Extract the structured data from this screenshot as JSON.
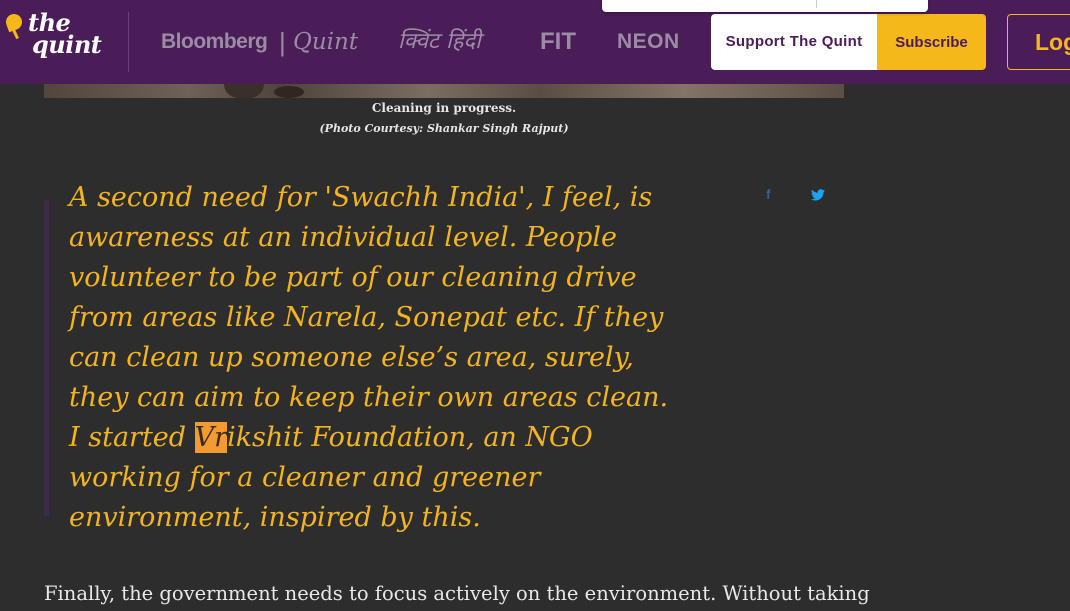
{
  "header": {
    "logo_top": "the",
    "logo_bottom": "quint",
    "brands": {
      "bloomberg": "Bloomberg",
      "separator": "|",
      "quint": "Quint",
      "hindi": "क्विंट हिंदी",
      "fit": "FIT",
      "neon": "NEON"
    },
    "support_label": "Support The Quint",
    "subscribe_label": "Subscribe",
    "login_label": "Log"
  },
  "article": {
    "caption": "Cleaning in progress.",
    "caption_credit": "(Photo Courtesy: Shankar Singh Rajput)",
    "quote": {
      "before": "A second need for 'Swachh India', I feel, is awareness at an individual level. People volunteer to be part of our cleaning drive from areas like Narela, Sonepat etc. If they can clean up someone else’s area, surely, they can aim to keep their own areas clean. I started ",
      "highlight": "Vr",
      "after": "ikshit Foundation, an NGO working for a cleaner and greener environment, inspired by this."
    },
    "share": {
      "facebook": "f",
      "facebook_icon": "facebook-icon",
      "twitter_icon": "twitter-icon"
    },
    "body": "Finally, the government needs to focus actively on the environment. Without taking"
  },
  "colors": {
    "header_bg": "#4a1c58",
    "page_bg": "#2d2d2d",
    "quote_text": "#f4b41e",
    "accent_yellow": "#f4b81a",
    "highlight": "#f39a30",
    "facebook": "#3b5998",
    "twitter": "#1da1f2"
  }
}
